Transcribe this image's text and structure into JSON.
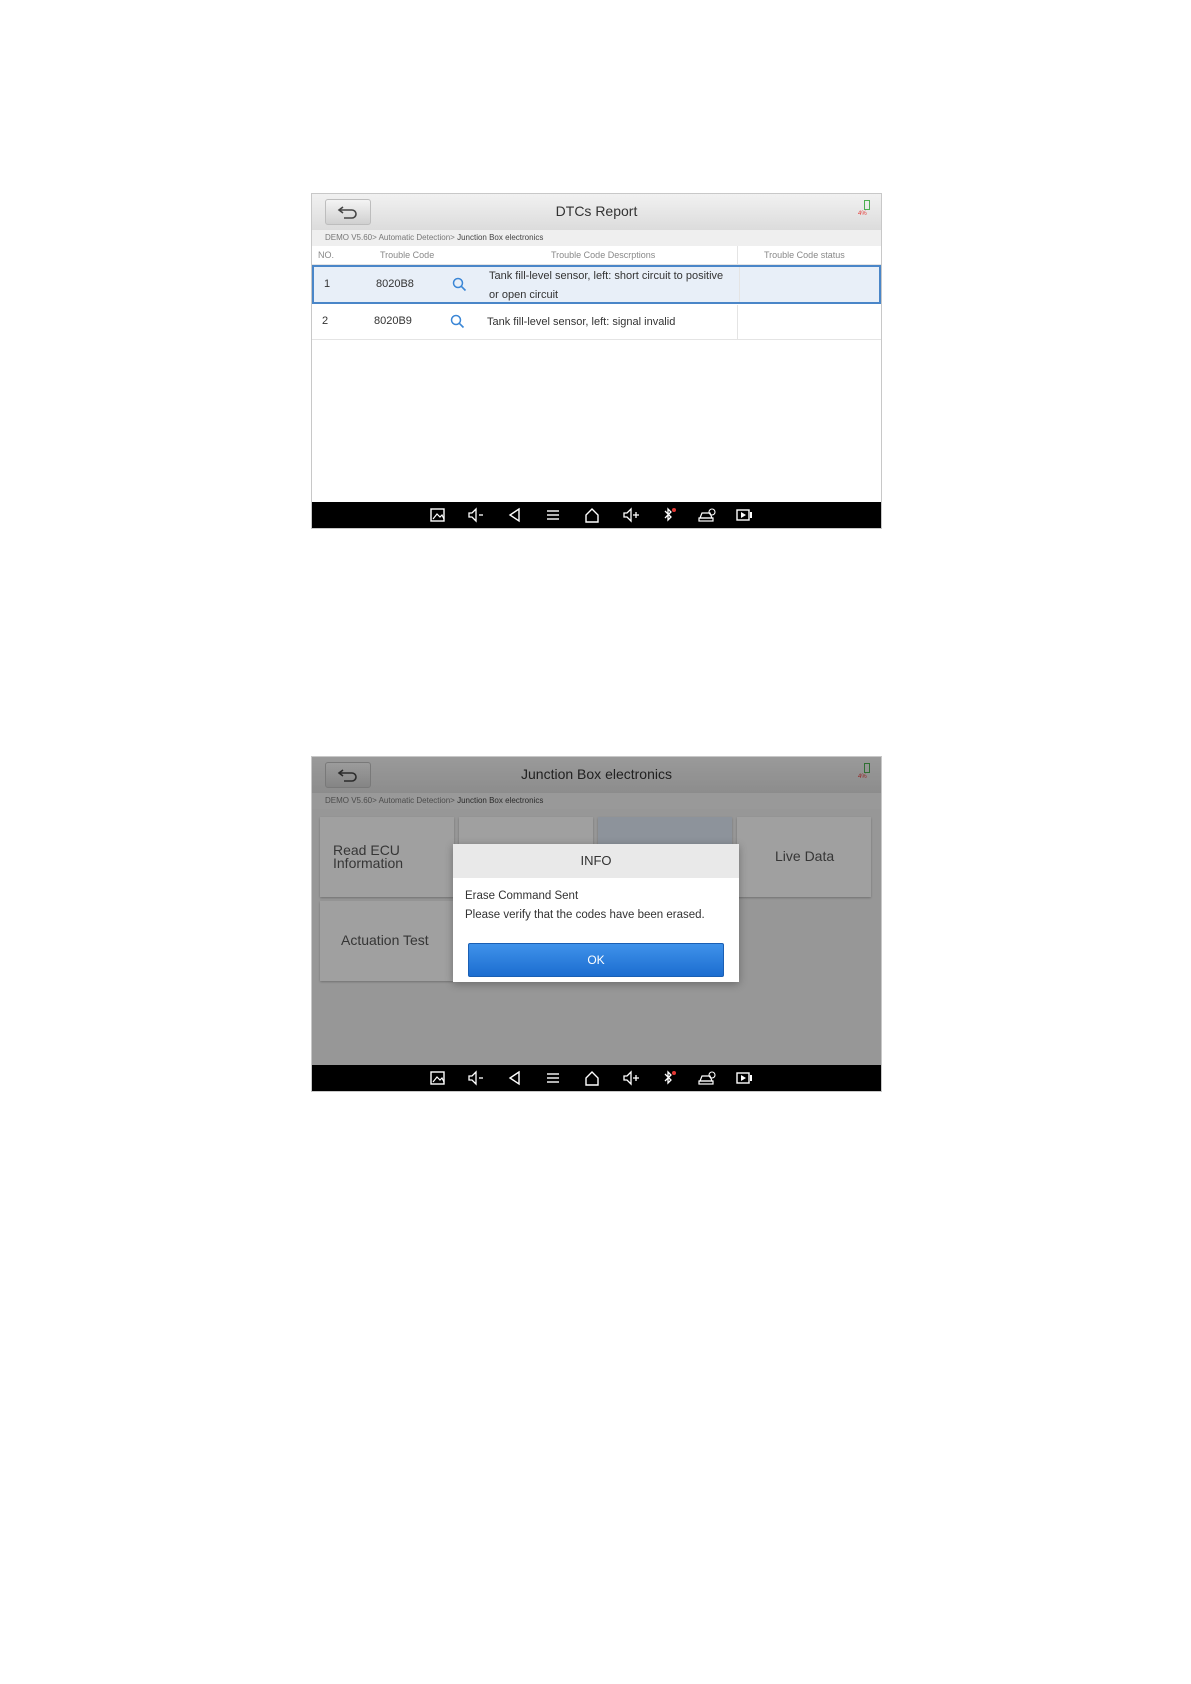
{
  "screen1": {
    "title": "DTCs Report",
    "battery_pct": "4%",
    "breadcrumb": {
      "path": "DEMO V5.60> Automatic Detection>",
      "current": " Junction Box electronics"
    },
    "columns": {
      "no": "NO.",
      "code": "Trouble Code",
      "description": "Trouble Code Descrptions",
      "status": "Trouble Code status"
    },
    "rows": [
      {
        "no": "1",
        "code": "8020B8",
        "description": "Tank fill-level sensor, left: short circuit to positive or open circuit",
        "status": ""
      },
      {
        "no": "2",
        "code": "8020B9",
        "description": "Tank fill-level sensor, left: signal invalid",
        "status": ""
      }
    ]
  },
  "screen2": {
    "title": "Junction Box electronics",
    "battery_pct": "4%",
    "breadcrumb": {
      "path": "DEMO V5.60> Automatic Detection>",
      "current": " Junction Box electronics"
    },
    "tiles": {
      "read_ecu_line1": "Read ECU",
      "read_ecu_line2": "Information",
      "live_data": "Live Data",
      "actuation_test": "Actuation Test"
    },
    "dialog": {
      "title": "INFO",
      "line1": "Erase Command Sent",
      "line2": "Please verify that the codes have been erased.",
      "ok": "OK"
    }
  },
  "colors": {
    "accent_blue": "#1c6dd0",
    "selected_row_border": "#4a86c8",
    "navbar": "#000000",
    "bluetooth_dot": "#e53935"
  },
  "navbar_icons": [
    "screenshot-icon",
    "volume-down-icon",
    "back-icon",
    "menu-icon",
    "home-icon",
    "volume-up-icon",
    "bluetooth-icon",
    "vci-car-icon",
    "screen-record-icon"
  ]
}
